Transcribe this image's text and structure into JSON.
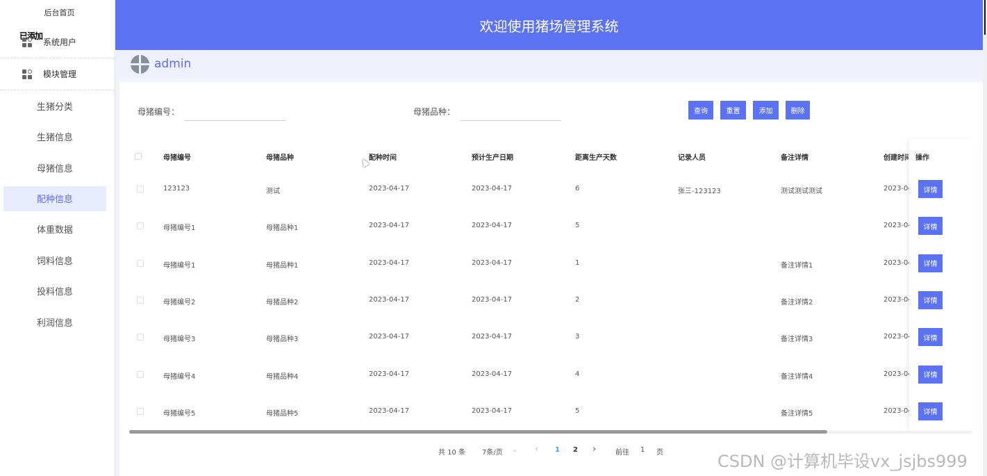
{
  "sidebar": {
    "home": "后台首页",
    "overlay_text": "已添加",
    "group_users": "系统用户",
    "group_modules": "模块管理",
    "items": [
      "生猪分类",
      "生猪信息",
      "母猪信息",
      "配种信息",
      "体重数据",
      "饲料信息",
      "投料信息",
      "利润信息"
    ],
    "active_item": "配种信息"
  },
  "header": {
    "title": "欢迎使用猪场管理系统"
  },
  "user": {
    "name": "admin"
  },
  "search": {
    "label_sow_id": "母猪编号：",
    "label_sow_breed": "母猪品种：",
    "value_sow_id": "",
    "value_sow_breed": "",
    "btn_query": "查询",
    "btn_reset": "重置",
    "btn_add": "添加",
    "btn_delete": "删除"
  },
  "table": {
    "headers": [
      "母猪编号",
      "母猪品种",
      "配种时间",
      "预计生产日期",
      "距离生产天数",
      "记录人员",
      "备注详情",
      "创建时间",
      "操作"
    ],
    "detail_label": "详情",
    "rows": [
      [
        "123123",
        "测试",
        "2023-04-17",
        "2023-04-17",
        "6",
        "张三-123123",
        "测试测试测试",
        "2023-04"
      ],
      [
        "母猪编号1",
        "母猪品种1",
        "2023-04-17",
        "2023-04-17",
        "5",
        "",
        "",
        "2023-04"
      ],
      [
        "母猪编号1",
        "母猪品种1",
        "2023-04-17",
        "2023-04-17",
        "1",
        "",
        "备注详情1",
        "2023-04"
      ],
      [
        "母猪编号2",
        "母猪品种2",
        "2023-04-17",
        "2023-04-17",
        "2",
        "",
        "备注详情2",
        "2023-04"
      ],
      [
        "母猪编号3",
        "母猪品种3",
        "2023-04-17",
        "2023-04-17",
        "3",
        "",
        "备注详情3",
        "2023-04"
      ],
      [
        "母猪编号4",
        "母猪品种4",
        "2023-04-17",
        "2023-04-17",
        "4",
        "",
        "备注详情4",
        "2023-04"
      ],
      [
        "母猪编号5",
        "母猪品种5",
        "2023-04-17",
        "2023-04-17",
        "5",
        "",
        "备注详情5",
        "2023-04"
      ]
    ]
  },
  "pagination": {
    "total": "共 10 条",
    "page_size": "7条/页",
    "prev": "‹",
    "pages": [
      "1",
      "2"
    ],
    "current": "1",
    "next": "›",
    "goto_label": "前往",
    "goto_value": "1",
    "goto_suffix": "页"
  },
  "watermark": "CSDN @计算机毕设vx_jsjbs999",
  "colors": {
    "primary": "#5b73f2",
    "active_bg": "#e8ecff",
    "active_text": "#5b6df0"
  }
}
